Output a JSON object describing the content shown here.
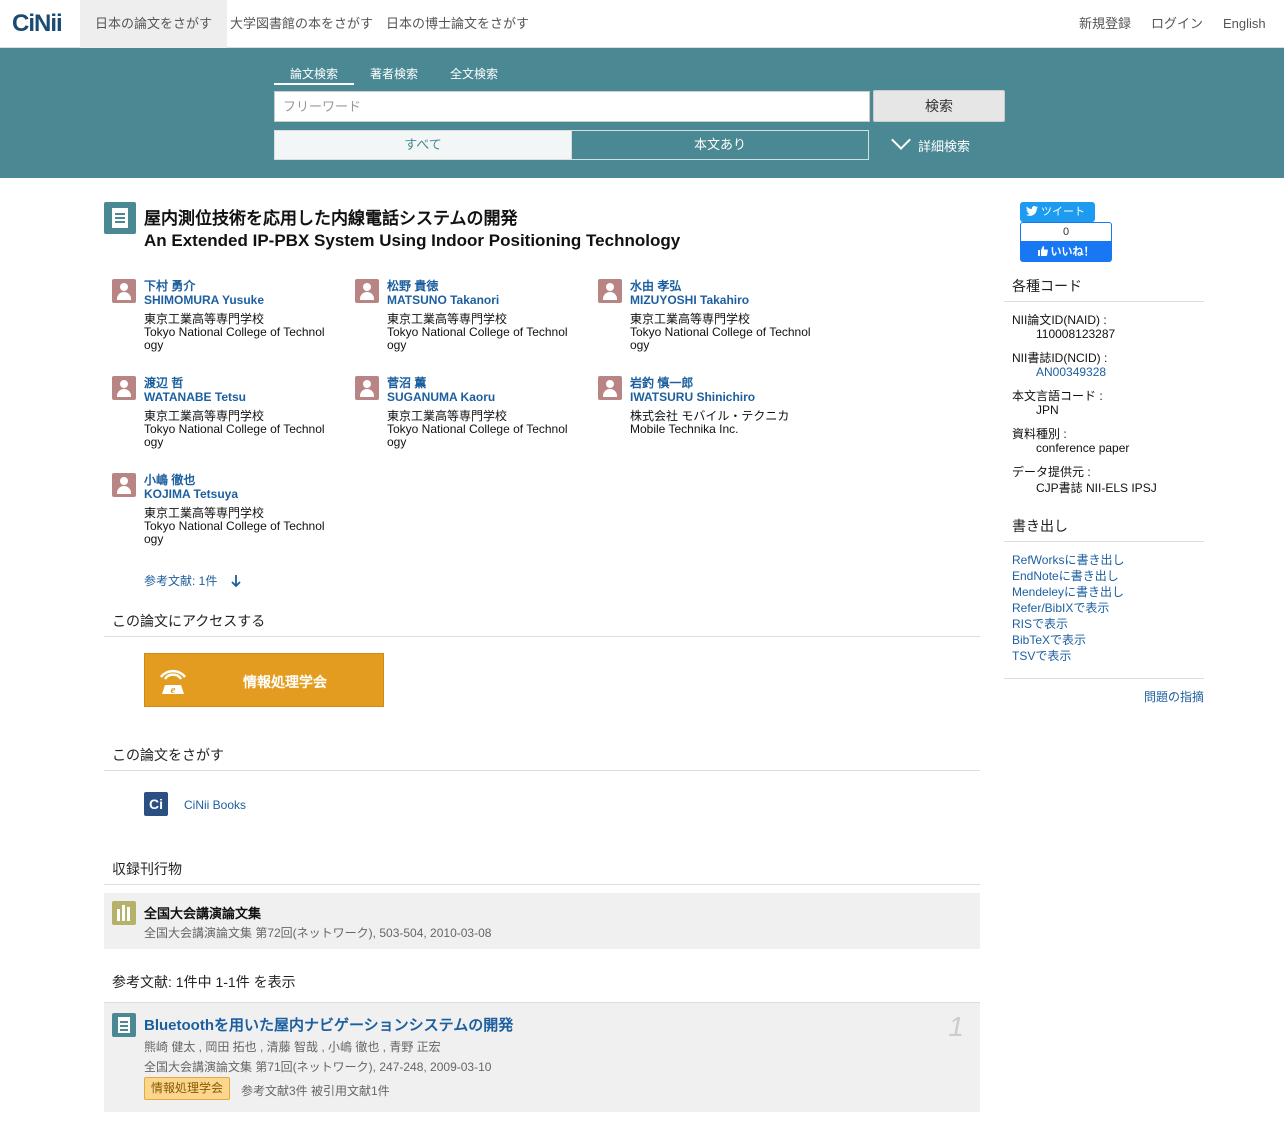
{
  "nav": {
    "logo": "CiNii",
    "tabs": [
      "日本の論文をさがす",
      "大学図書館の本をさがす",
      "日本の博士論文をさがす"
    ],
    "right": [
      "新規登録",
      "ログイン",
      "English"
    ]
  },
  "search": {
    "tabs": [
      "論文検索",
      "著者検索",
      "全文検索"
    ],
    "placeholder": "フリーワード",
    "button": "検索",
    "filters": [
      "すべて",
      "本文あり"
    ],
    "advanced": "詳細検索"
  },
  "article": {
    "title_ja": "屋内測位技術を応用した内線電話システムの開発",
    "title_en": "An Extended IP-PBX System Using Indoor Positioning Technology",
    "authors": [
      {
        "ja": "下村 勇介",
        "en": "SHIMOMURA Yusuke",
        "aff_ja": "東京工業高等専門学校",
        "aff_en1": "Tokyo National College of Technol",
        "aff_en2": "ogy"
      },
      {
        "ja": "松野 貴徳",
        "en": "MATSUNO Takanori",
        "aff_ja": "東京工業高等専門学校",
        "aff_en1": "Tokyo National College of Technol",
        "aff_en2": "ogy"
      },
      {
        "ja": "水由 孝弘",
        "en": "MIZUYOSHI Takahiro",
        "aff_ja": "東京工業高等専門学校",
        "aff_en1": "Tokyo National College of Technol",
        "aff_en2": "ogy"
      },
      {
        "ja": "渡辺 哲",
        "en": "WATANABE Tetsu",
        "aff_ja": "東京工業高等専門学校",
        "aff_en1": "Tokyo National College of Technol",
        "aff_en2": "ogy"
      },
      {
        "ja": "菅沼 薫",
        "en": "SUGANUMA Kaoru",
        "aff_ja": "東京工業高等専門学校",
        "aff_en1": "Tokyo National College of Technol",
        "aff_en2": "ogy"
      },
      {
        "ja": "岩釣 慎一郎",
        "en": "IWATSURU Shinichiro",
        "aff_ja": "株式会社 モバイル・テクニカ",
        "aff_en1": "Mobile Technika Inc.",
        "aff_en2": ""
      },
      {
        "ja": "小嶋 徹也",
        "en": "KOJIMA Tetsuya",
        "aff_ja": "東京工業高等専門学校",
        "aff_en1": "Tokyo National College of Technol",
        "aff_en2": "ogy"
      }
    ],
    "refs_link": "参考文献: 1件"
  },
  "access": {
    "heading": "この論文にアクセスする",
    "button": "情報処理学会"
  },
  "find": {
    "heading": "この論文をさがす",
    "cinii_books": "CiNii Books"
  },
  "journal": {
    "heading": "収録刊行物",
    "title": "全国大会講演論文集",
    "sub": "全国大会講演論文集 第72回(ネットワーク), 503-504, 2010-03-08"
  },
  "references": {
    "heading": "参考文献:  1件中 1-1件 を表示",
    "items": [
      {
        "num": "1",
        "title": "Bluetoothを用いた屋内ナビゲーションシステムの開発",
        "authors": "熊崎 健太 , 岡田 拓也 , 清藤 智哉 , 小嶋 徹也 , 青野 正宏",
        "pub": "全国大会講演論文集 第71回(ネットワーク), 247-248, 2009-03-10",
        "badge": "情報処理学会",
        "meta": "参考文献3件   被引用文献1件"
      }
    ]
  },
  "social": {
    "tweet": "ツイート",
    "like_count": "0",
    "like": "いいね！"
  },
  "codes": {
    "heading": "各種コード",
    "items": [
      {
        "label": "NII論文ID(NAID) :",
        "value": "110008123287"
      },
      {
        "label": "NII書誌ID(NCID) :",
        "value": "AN00349328"
      },
      {
        "label": "本文言語コード :",
        "value": "JPN"
      },
      {
        "label": "資料種別 :",
        "value": "conference paper"
      },
      {
        "label": "データ提供元 :",
        "value": "CJP書誌  NII-ELS  IPSJ"
      }
    ]
  },
  "export": {
    "heading": "書き出し",
    "links": [
      "RefWorksに書き出し",
      "EndNoteに書き出し",
      "Mendeleyに書き出し",
      "Refer/BibIXで表示",
      "RISで表示",
      "BibTeXで表示",
      "TSVで表示"
    ]
  },
  "problem": "問題の指摘"
}
